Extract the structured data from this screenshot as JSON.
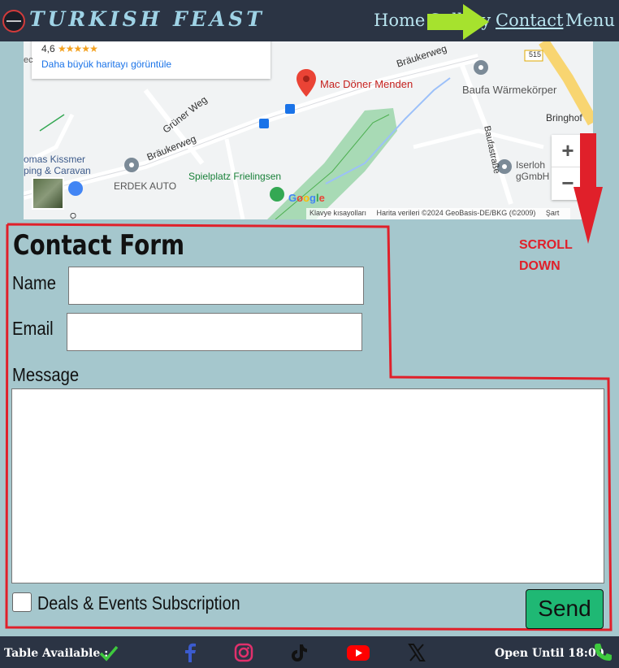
{
  "nav": {
    "brand": "TURKISH FEAST",
    "links": [
      "Home",
      "Gallery",
      "Contact",
      "Menu"
    ]
  },
  "map": {
    "rating": "4,6",
    "stars": "★★★★★",
    "larger_map_link": "Daha büyük haritayı görüntüle",
    "labels": {
      "street_top": "Bräukerweg",
      "street_left": "Bräukerweg",
      "gruner": "Grüner Weg",
      "place_pin": "Mac Döner Menden",
      "baufa": "Baufa Wärmekörper",
      "baufastrasse": "Baufastraße",
      "bringhof": "Bringhof",
      "kissmer_1": "omas Kissmer",
      "kissmer_2": "ping & Caravan",
      "erdek": "ERDEK AUTO",
      "spielplatz": "Spielplatz Frielingsen",
      "iserlohn_1": "Iserloh",
      "iserlohn_2": "gGmbH",
      "road_number": "515",
      "side_letter": "ec",
      "vertical": "Oe"
    },
    "google": "Google",
    "attribution": {
      "shortcuts": "Klavye kısayolları",
      "data": "Harita verileri ©2024 GeoBasis-DE/BKG (©2009)",
      "terms": "Şart"
    },
    "zoom_in": "+",
    "zoom_out": "−"
  },
  "annotation": {
    "scroll_line1": "SCROLL",
    "scroll_line2": "DOWN",
    "red": "#e0202a",
    "green": "#a6e22e"
  },
  "form": {
    "title": "Contact Form",
    "name_label": "Name",
    "email_label": "Email",
    "message_label": "Message",
    "name_value": "",
    "email_value": "",
    "message_value": "",
    "subscription_label": "Deals & Events Subscription",
    "send_label": "Send"
  },
  "footer": {
    "table_available": "Table Available :",
    "open_until": "Open Until 18:00",
    "social_icons": [
      "facebook-icon",
      "instagram-icon",
      "tiktok-icon",
      "youtube-icon",
      "x-icon"
    ]
  },
  "colors": {
    "navbar": "#2b3444",
    "page_bg": "#a5c7cd",
    "send_button": "#1fb874",
    "brand_text": "#9fd3e6"
  }
}
